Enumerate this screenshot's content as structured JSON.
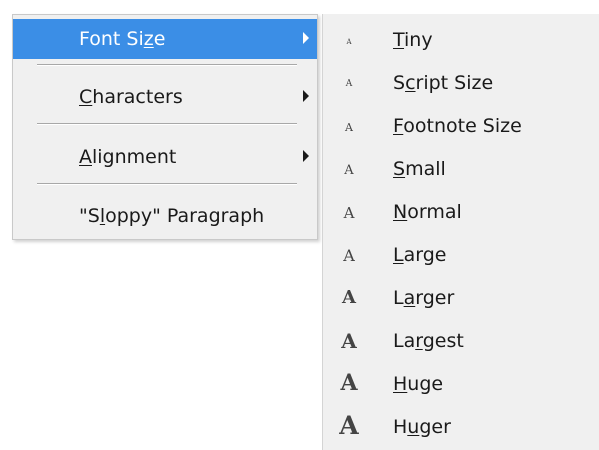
{
  "menu": {
    "items": [
      {
        "pre": "Font Si",
        "ul": "z",
        "post": "e",
        "submenu": true,
        "highlighted": true
      },
      {
        "pre": "",
        "ul": "C",
        "post": "haracters",
        "submenu": true,
        "highlighted": false
      },
      {
        "pre": "",
        "ul": "A",
        "post": "lignment",
        "submenu": true,
        "highlighted": false
      },
      {
        "pre": "\"S",
        "ul": "l",
        "post": "oppy\" Paragraph",
        "submenu": false,
        "highlighted": false
      }
    ]
  },
  "submenu": {
    "glyph_char": "A",
    "items": [
      {
        "pre": "",
        "ul": "T",
        "post": "iny"
      },
      {
        "pre": "S",
        "ul": "c",
        "post": "ript Size"
      },
      {
        "pre": "",
        "ul": "F",
        "post": "ootnote Size"
      },
      {
        "pre": "",
        "ul": "S",
        "post": "mall"
      },
      {
        "pre": "",
        "ul": "N",
        "post": "ormal"
      },
      {
        "pre": "",
        "ul": "L",
        "post": "arge"
      },
      {
        "pre": "L",
        "ul": "a",
        "post": "rger"
      },
      {
        "pre": "La",
        "ul": "r",
        "post": "gest"
      },
      {
        "pre": "",
        "ul": "H",
        "post": "uge"
      },
      {
        "pre": "H",
        "ul": "u",
        "post": "ger"
      }
    ]
  },
  "colors": {
    "highlight": "#3b8ee6",
    "menu_bg": "#f0f0f0"
  }
}
